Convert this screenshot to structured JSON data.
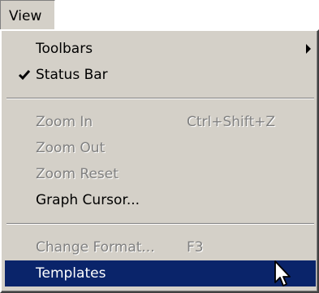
{
  "menubar": {
    "view_label": "View"
  },
  "menu": {
    "toolbars": {
      "label": "Toolbars",
      "has_submenu": true,
      "submenu_icon": "triangle-right-icon"
    },
    "status_bar": {
      "label": "Status Bar",
      "checked": true,
      "check_icon": "checkmark-icon"
    },
    "zoom_in": {
      "label": "Zoom In",
      "shortcut": "Ctrl+Shift+Z",
      "enabled": false
    },
    "zoom_out": {
      "label": "Zoom Out",
      "enabled": false
    },
    "zoom_reset": {
      "label": "Zoom Reset",
      "enabled": false
    },
    "graph_cursor": {
      "label": "Graph Cursor...",
      "enabled": true
    },
    "change_format": {
      "label": "Change Format...",
      "shortcut": "F3",
      "enabled": false
    },
    "templates": {
      "label": "Templates",
      "enabled": true,
      "highlighted": true
    }
  },
  "colors": {
    "menu_background": "#d4d0c8",
    "highlight": "#0a246a",
    "disabled_text": "#808080"
  },
  "mouse_cursor_icon": "arrow-pointer-icon"
}
